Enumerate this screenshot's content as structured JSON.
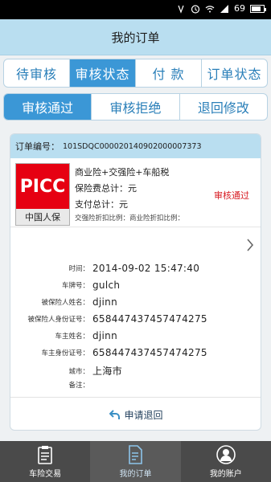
{
  "status_bar": {
    "battery_text": "69"
  },
  "header": {
    "title": "我的订单"
  },
  "main_tabs": [
    {
      "label": "待审核",
      "active": false
    },
    {
      "label": "审核状态",
      "active": true
    },
    {
      "label": "付 款",
      "active": false
    },
    {
      "label": "订单状态",
      "active": false
    }
  ],
  "sub_tabs": [
    {
      "label": "审核通过",
      "active": true
    },
    {
      "label": "审核拒绝",
      "active": false
    },
    {
      "label": "退回修改",
      "active": false
    }
  ],
  "order": {
    "number_label": "订单编号：",
    "number": "101SDQC000020140902000007373",
    "logo_text": "PICC",
    "logo_cn": "中国人保",
    "product": "商业险+交强险+车船税",
    "premium": "保险费总计：元",
    "paid": "支付总计：元",
    "discount": "交强险折扣比例：商业险折扣比例：",
    "status": "审核通过",
    "details": [
      {
        "label": "时间：",
        "value": "2014-09-02 15:47:40"
      },
      {
        "label": "车牌号：",
        "value": "gulch"
      },
      {
        "label": "被保险人姓名：",
        "value": "djinn"
      },
      {
        "label": "被保险人身份证号：",
        "value": "658447437457474275"
      },
      {
        "label": "车主姓名：",
        "value": "djinn"
      },
      {
        "label": "车主身份证号：",
        "value": "658447437457474275"
      },
      {
        "label": "城市：",
        "value": "上海市"
      },
      {
        "label": "备注：",
        "value": ""
      }
    ],
    "return_button": "申请退回"
  },
  "bottom_nav": [
    {
      "label": "车险交易",
      "icon": "clipboard-icon",
      "active": false
    },
    {
      "label": "我的订单",
      "icon": "document-icon",
      "active": true
    },
    {
      "label": "我的账户",
      "icon": "user-icon",
      "active": false
    }
  ],
  "colors": {
    "accent": "#3b97d6",
    "header_bg": "#b9def0",
    "status_red": "#d71920",
    "nav_bg": "#4a4a4a"
  }
}
